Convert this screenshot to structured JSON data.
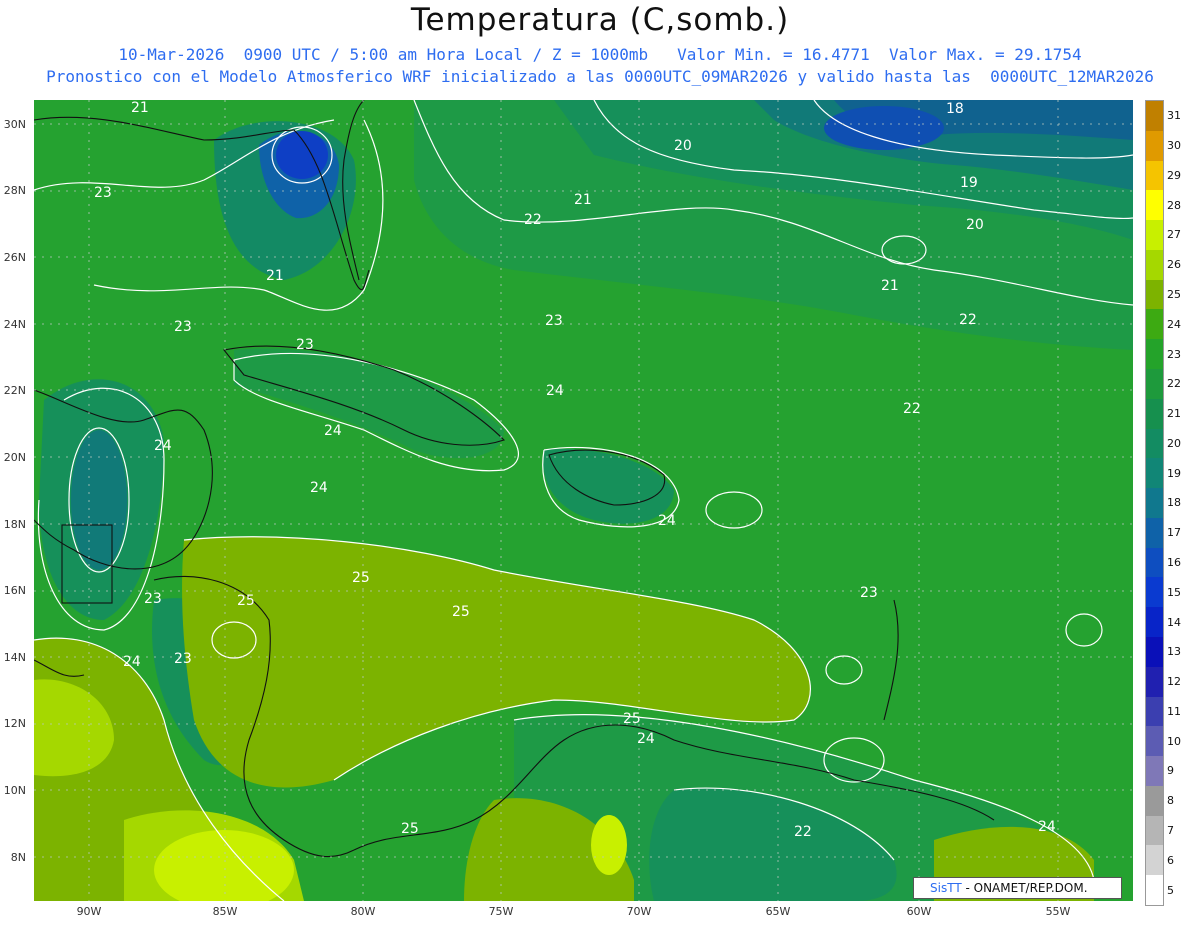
{
  "header": {
    "title": "Temperatura (C,somb.)",
    "line1": "10-Mar-2026  0900 UTC / 5:00 am Hora Local / Z = 1000mb   Valor Min. = 16.4771  Valor Max. = 29.1754",
    "line2": "Pronostico con el Modelo Atmosferico WRF inicializado a las 0000UTC_09MAR2026 y valido hasta las  0000UTC_12MAR2026"
  },
  "axes": {
    "lat_labels": [
      "30N",
      "28N",
      "26N",
      "24N",
      "22N",
      "20N",
      "18N",
      "16N",
      "14N",
      "12N",
      "10N",
      "8N"
    ],
    "lon_labels": [
      "90W",
      "85W",
      "80W",
      "75W",
      "70W",
      "65W",
      "60W",
      "55W"
    ]
  },
  "colorbar": {
    "labels": [
      "31",
      "30",
      "29",
      "28",
      "27",
      "26",
      "25",
      "24",
      "23",
      "22",
      "21",
      "20",
      "19",
      "18",
      "17",
      "16",
      "15",
      "14",
      "13",
      "12",
      "11",
      "10",
      "9",
      "8",
      "7",
      "6",
      "5"
    ],
    "colors": [
      "#c08000",
      "#e09a00",
      "#f5c400",
      "#ffff00",
      "#c8f000",
      "#a5d800",
      "#7db300",
      "#3daa12",
      "#24a32a",
      "#1e9a3c",
      "#16904e",
      "#138c62",
      "#118676",
      "#10788e",
      "#0f62a8",
      "#0e4ec0",
      "#0a3ad0",
      "#0824c8",
      "#0a10b8",
      "#2020b0",
      "#3b3fb0",
      "#5c5cb3",
      "#7f78b7",
      "#9a9a9a",
      "#b5b5b5",
      "#d3d3d3",
      "#ffffff"
    ]
  },
  "badge": {
    "logo": "SisTT",
    "text": "- ONAMET/REP.DOM."
  },
  "contour_labels": [
    "21",
    "23",
    "21",
    "20",
    "21",
    "22",
    "18",
    "19",
    "20",
    "21",
    "22",
    "23",
    "23",
    "23",
    "22",
    "24",
    "24",
    "24",
    "23",
    "24",
    "25",
    "25",
    "25",
    "24",
    "23",
    "24",
    "23",
    "24",
    "25",
    "24",
    "22",
    "25"
  ]
}
